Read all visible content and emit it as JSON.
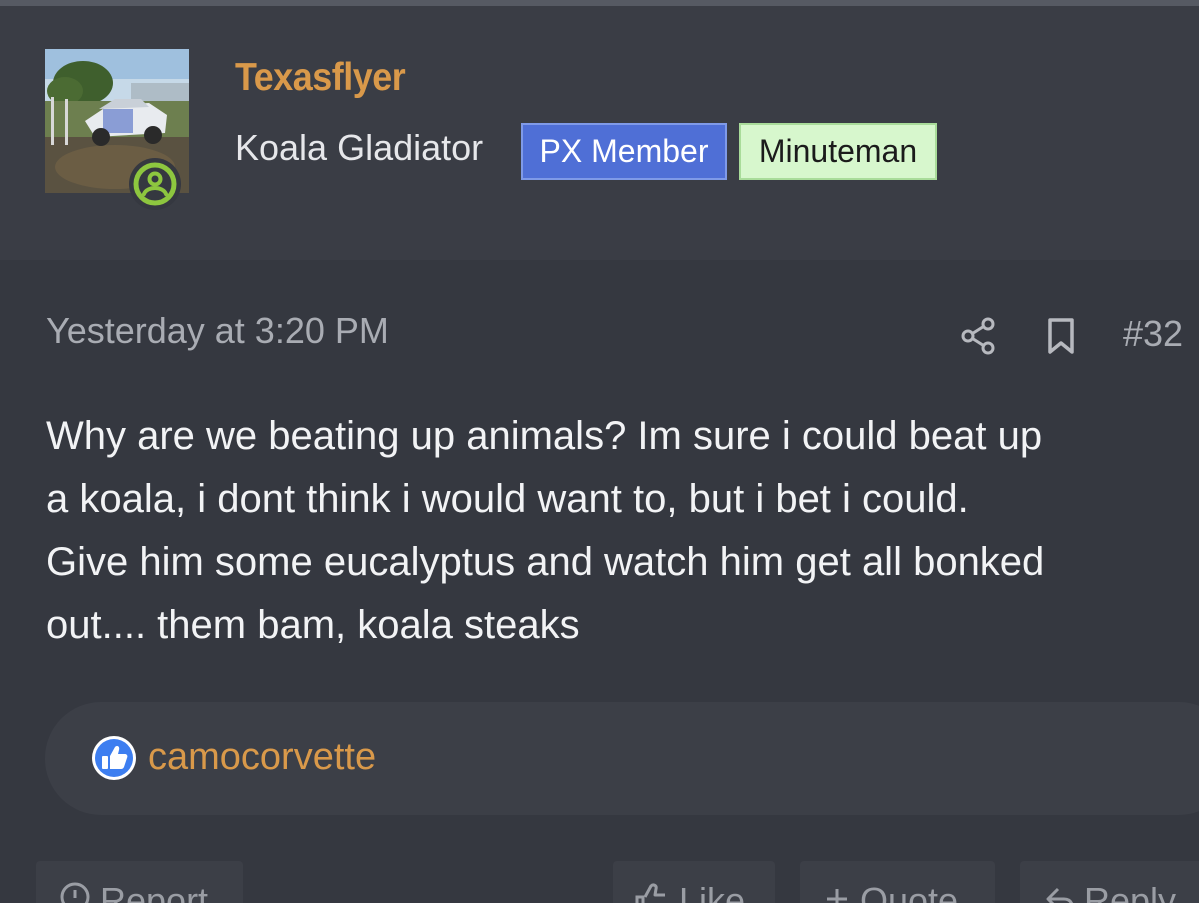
{
  "user": {
    "name": "Texasflyer",
    "title": "Koala Gladiator",
    "banners": [
      "PX Member",
      "Minuteman"
    ]
  },
  "post": {
    "date": "Yesterday at 3:20 PM",
    "number": "#32",
    "body_lines": [
      "Why are we beating up animals? Im sure i could beat up",
      "a koala, i dont think i would want to, but i bet i could.",
      "Give him some eucalyptus and watch him get all bonked",
      "out.... them bam, koala steaks"
    ]
  },
  "reactions": {
    "icon": "like-icon",
    "user": "camocorvette"
  },
  "actions": {
    "report": "Report",
    "like": "Like",
    "quote": "Quote",
    "reply": "Reply"
  },
  "colors": {
    "background": "#353840",
    "header_background": "#3a3d45",
    "accent_username": "#d9994a",
    "banner_px_member": "#4f6fd6",
    "banner_minuteman": "#d7f7cd",
    "online_indicator": "#8dc63f",
    "like_blue": "#3d7ef0"
  },
  "icons": {
    "share": "share-icon",
    "bookmark": "bookmark-icon",
    "online": "online-status-icon",
    "report": "report-icon",
    "like": "thumbs-up-icon",
    "quote": "plus-icon",
    "reply": "reply-icon"
  }
}
